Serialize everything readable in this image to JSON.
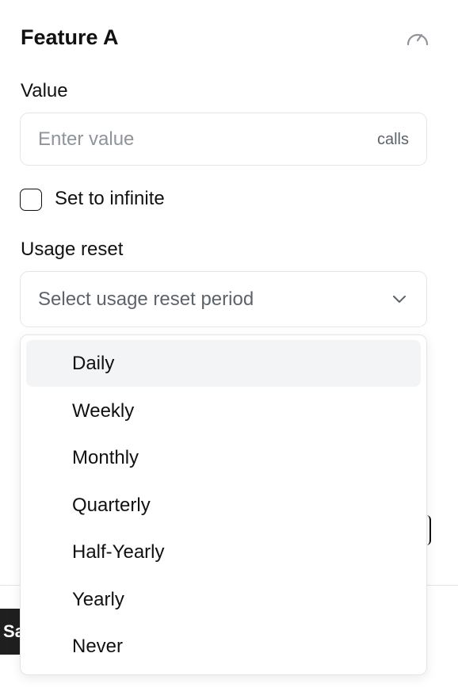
{
  "feature": {
    "title": "Feature A",
    "icon": "gauge-icon"
  },
  "value": {
    "label": "Value",
    "placeholder": "Enter value",
    "current": "",
    "suffix": "calls"
  },
  "infinite": {
    "label": "Set to infinite",
    "checked": false
  },
  "usage_reset": {
    "label": "Usage reset",
    "placeholder": "Select usage reset period",
    "options": [
      {
        "label": "Daily",
        "highlighted": true
      },
      {
        "label": "Weekly",
        "highlighted": false
      },
      {
        "label": "Monthly",
        "highlighted": false
      },
      {
        "label": "Quarterly",
        "highlighted": false
      },
      {
        "label": "Half-Yearly",
        "highlighted": false
      },
      {
        "label": "Yearly",
        "highlighted": false
      },
      {
        "label": "Never",
        "highlighted": false
      }
    ]
  },
  "footer": {
    "save_label": "Sa"
  },
  "colors": {
    "text": "#111111",
    "muted": "#5d636a",
    "placeholder": "#8f949b",
    "border": "#e3e5e9",
    "highlight": "#f3f4f6",
    "button": "#1f1f1f"
  }
}
